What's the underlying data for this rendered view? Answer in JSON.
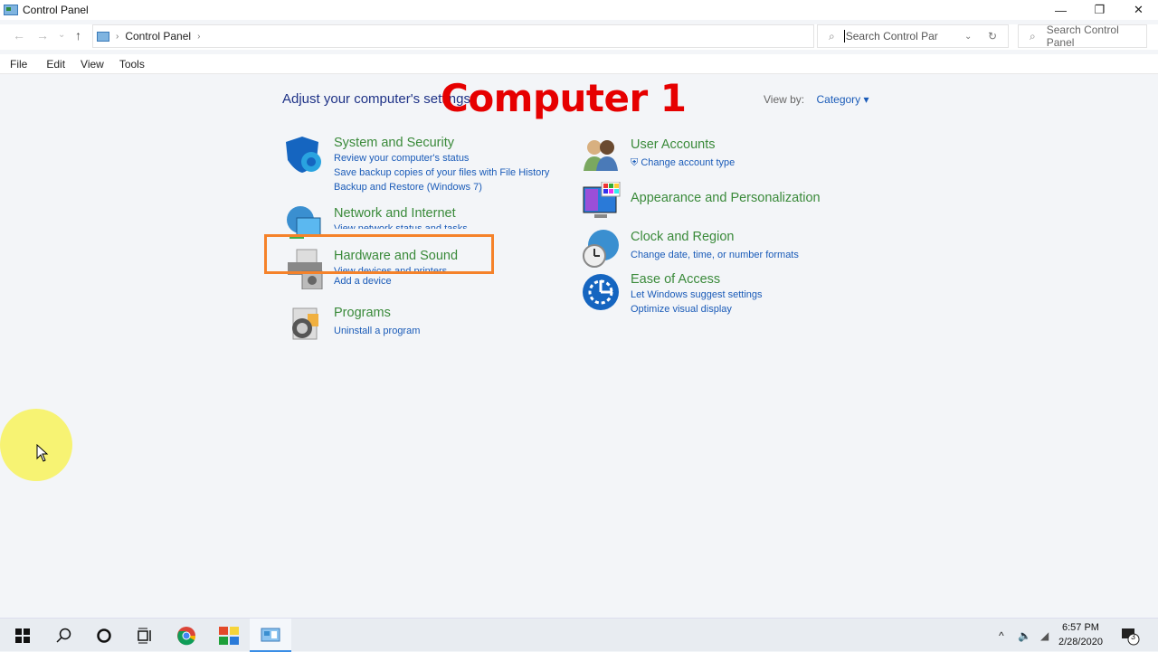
{
  "window": {
    "title": "Control Panel",
    "controls": {
      "minimize": "—",
      "maximize": "❐",
      "close": "✕"
    }
  },
  "nav": {
    "back_icon": "←",
    "forward_icon": "→",
    "recent_icon": "⌄",
    "up_icon": "↑",
    "breadcrumb": [
      "Control Panel"
    ],
    "separator": "›",
    "search_value": "Search Control Par",
    "search_placeholder": "Search Control Panel",
    "dropdown_icon": "⌄",
    "refresh_icon": "↻",
    "search_icon": "⌕"
  },
  "menu": [
    "File",
    "Edit",
    "View",
    "Tools"
  ],
  "main": {
    "heading": "Adjust your computer's settings",
    "view_by_label": "View by:",
    "view_by_value": "Category",
    "overlay_text": "Computer 1",
    "categories_left": [
      {
        "name": "System and Security",
        "links": [
          "Review your computer's status",
          "Save backup copies of your files with File History",
          "Backup and Restore (Windows 7)"
        ]
      },
      {
        "name": "Network and Internet",
        "links": [
          "View network status and tasks"
        ]
      },
      {
        "name": "Hardware and Sound",
        "links": [
          "View devices and printers",
          "Add a device"
        ]
      },
      {
        "name": "Programs",
        "links": [
          "Uninstall a program"
        ]
      }
    ],
    "categories_right": [
      {
        "name": "User Accounts",
        "links": [
          "Change account type"
        ]
      },
      {
        "name": "Appearance and Personalization",
        "links": []
      },
      {
        "name": "Clock and Region",
        "links": [
          "Change date, time, or number formats"
        ]
      },
      {
        "name": "Ease of Access",
        "links": [
          "Let Windows suggest settings",
          "Optimize visual display"
        ]
      }
    ]
  },
  "taskbar": {
    "apps": [
      "start",
      "search",
      "cortana",
      "task-view",
      "chrome",
      "app-grid",
      "control-panel"
    ],
    "time": "6:57 PM",
    "date": "2/28/2020",
    "notification_count": "3"
  },
  "colors": {
    "highlight": "#f5822a",
    "overlay": "#e60000",
    "category": "#3a8a3a",
    "link": "#1a5bb8"
  }
}
